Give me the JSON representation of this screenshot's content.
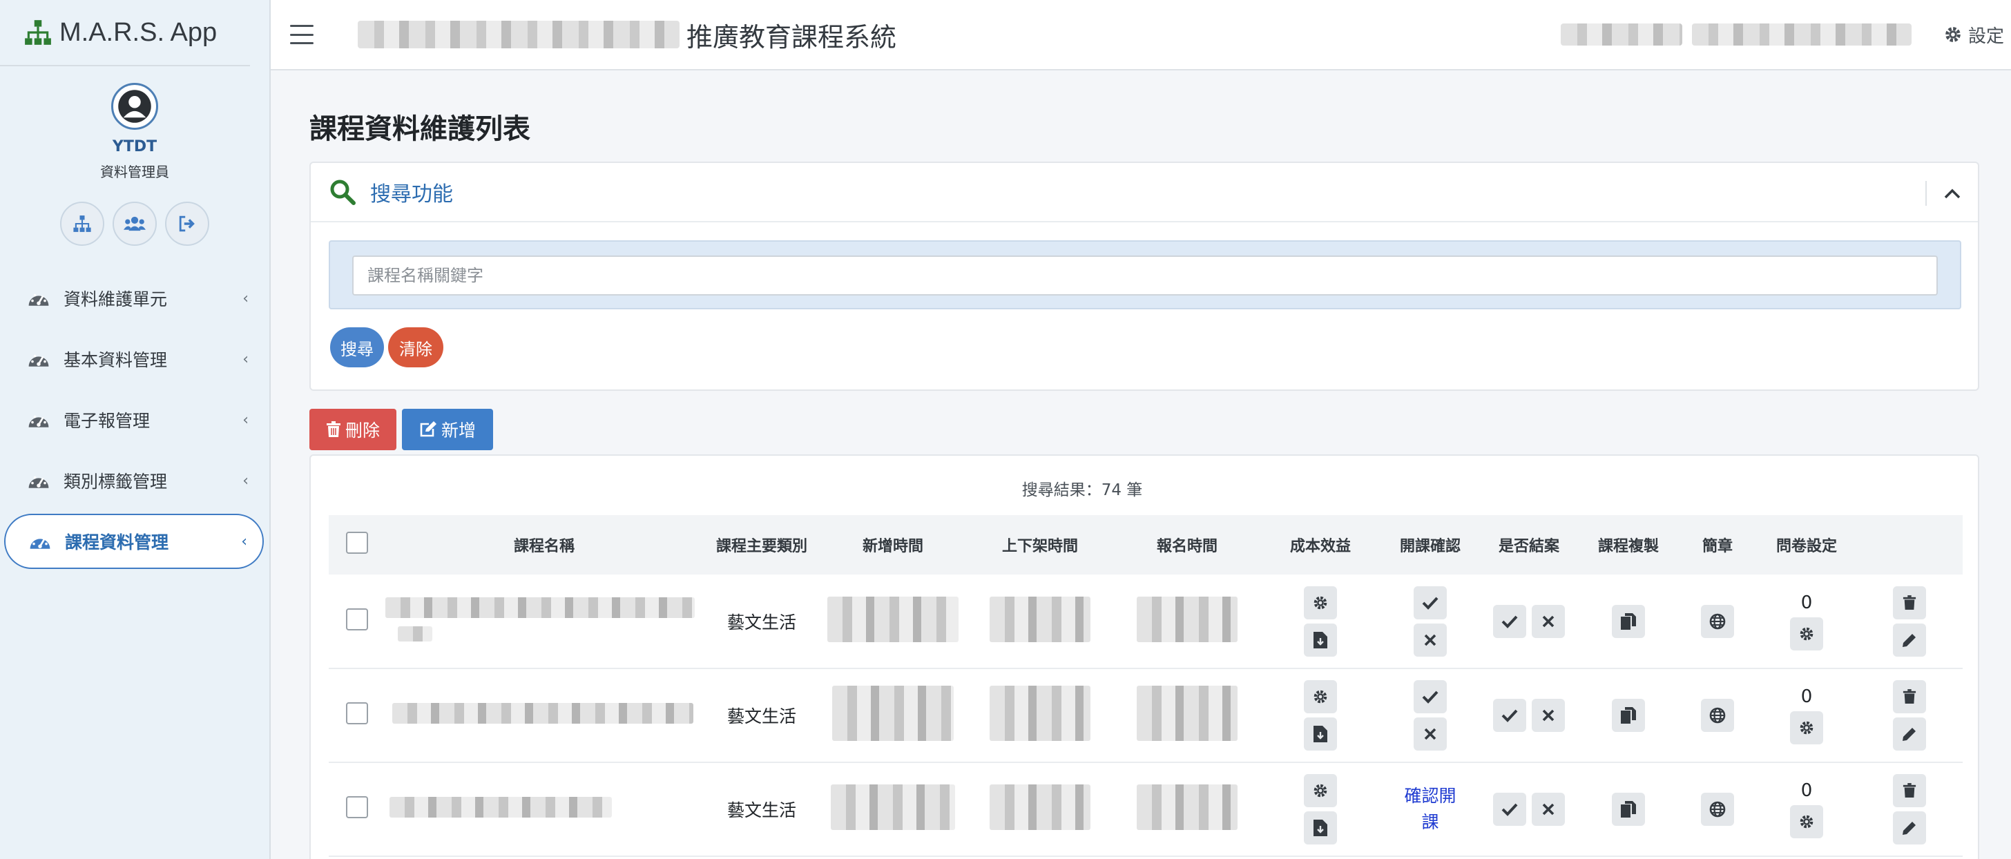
{
  "app": {
    "name": "M.A.R.S. App"
  },
  "user": {
    "name": "YTDT",
    "role": "資料管理員"
  },
  "sidebar": {
    "quick_actions": [
      "sitemap-icon",
      "users-icon",
      "sign-out-icon"
    ],
    "items": [
      {
        "label": "資料維護單元",
        "active": false
      },
      {
        "label": "基本資料管理",
        "active": false
      },
      {
        "label": "電子報管理",
        "active": false
      },
      {
        "label": "類別標籤管理",
        "active": false
      },
      {
        "label": "課程資料管理",
        "active": true
      }
    ]
  },
  "topbar": {
    "system_title": "推廣教育課程系統",
    "settings_label": "設定"
  },
  "page": {
    "title": "課程資料維護列表"
  },
  "search": {
    "title": "搜尋功能",
    "placeholder": "課程名稱關鍵字",
    "value": "",
    "search_label": "搜尋",
    "clear_label": "清除"
  },
  "actions": {
    "delete_label": "刪除",
    "add_label": "新增"
  },
  "table": {
    "result_text": "搜尋結果：74 筆",
    "columns": [
      "課程名稱",
      "課程主要類別",
      "新增時間",
      "上下架時間",
      "報名時間",
      "成本效益",
      "開課確認",
      "是否結案",
      "課程複製",
      "簡章",
      "問卷設定"
    ],
    "rows": [
      {
        "category": "藝文生活",
        "confirm_text": "",
        "survey_count": "0"
      },
      {
        "category": "藝文生活",
        "confirm_text": "",
        "survey_count": "0"
      },
      {
        "category": "藝文生活",
        "confirm_text": "確認開課",
        "survey_count": "0"
      }
    ]
  },
  "colors": {
    "primary": "#3f7fca",
    "danger": "#d9534f",
    "sidebar_bg": "#eaf2f8",
    "brand_green": "#2e7d32"
  }
}
